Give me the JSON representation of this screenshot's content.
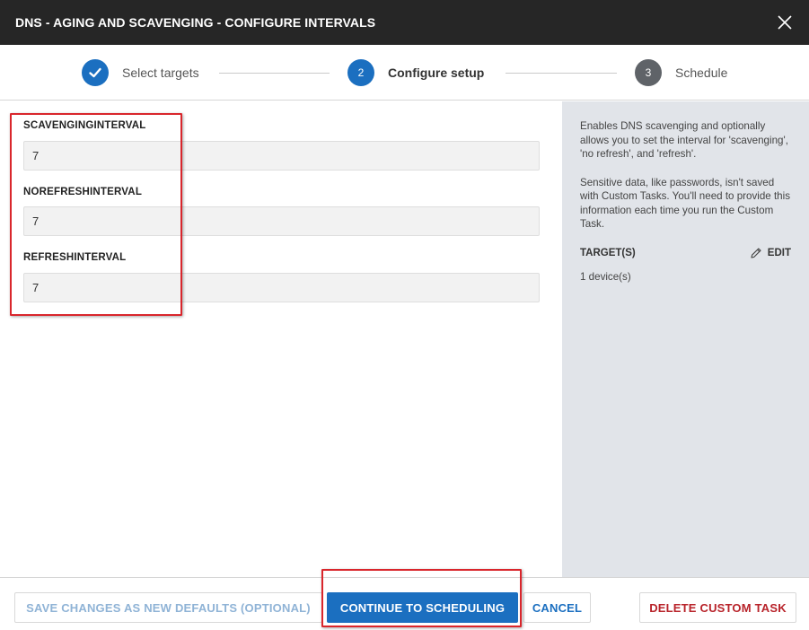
{
  "dialog": {
    "title": "DNS - AGING AND SCAVENGING - CONFIGURE INTERVALS"
  },
  "steps": [
    {
      "number": "1",
      "label": "Select targets",
      "state": "done"
    },
    {
      "number": "2",
      "label": "Configure setup",
      "state": "active"
    },
    {
      "number": "3",
      "label": "Schedule",
      "state": "pending"
    }
  ],
  "fields": [
    {
      "label": "SCAVENGINGINTERVAL",
      "value": "7"
    },
    {
      "label": "NOREFRESHINTERVAL",
      "value": "7"
    },
    {
      "label": "REFRESHINTERVAL",
      "value": "7"
    }
  ],
  "sidebar": {
    "description": "Enables DNS scavenging and optionally allows you to set the interval for 'scavenging', 'no refresh', and 'refresh'.",
    "note": "Sensitive data, like passwords, isn't saved with Custom Tasks. You'll need to provide this information each time you run the Custom Task.",
    "targets_title": "TARGET(S)",
    "edit_label": "EDIT",
    "device_count": "1 device(s)"
  },
  "footer": {
    "save_defaults_label": "SAVE CHANGES AS NEW DEFAULTS (OPTIONAL)",
    "continue_label": "CONTINUE TO SCHEDULING",
    "cancel_label": "CANCEL",
    "delete_label": "DELETE CUSTOM TASK"
  },
  "colors": {
    "titlebar": "#262626",
    "accent": "#1b6fc0",
    "danger": "#b8232a",
    "highlight": "#d9262c",
    "sidebar_bg": "#e1e4e9"
  }
}
